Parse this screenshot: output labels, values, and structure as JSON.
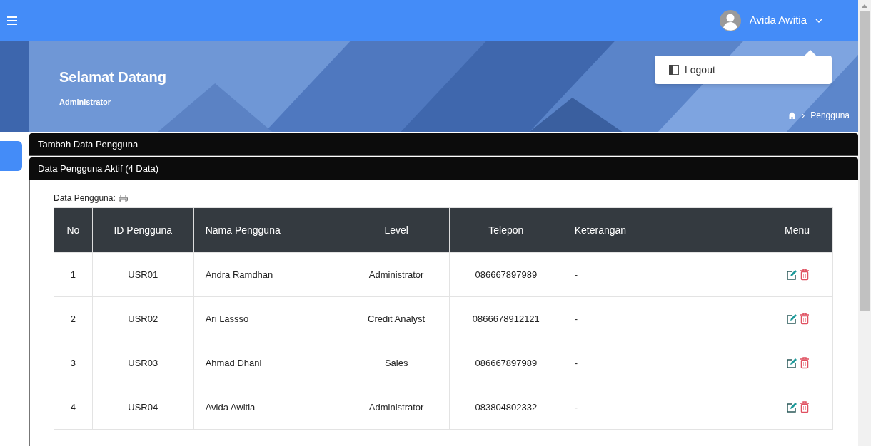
{
  "topbar": {
    "user_name": "Avida Awitia"
  },
  "user_menu": {
    "expanded": true,
    "items": [
      "Logout"
    ]
  },
  "banner": {
    "title": "Selamat Datang",
    "subtitle": "Administrator",
    "breadcrumb_separator": "›",
    "breadcrumb": "Pengguna"
  },
  "panels": [
    {
      "title": "Tambah Data Pengguna",
      "expanded": false
    },
    {
      "title": "Data Pengguna Aktif (4 Data)",
      "expanded": true
    }
  ],
  "table": {
    "caption": "Data Pengguna:",
    "columns": [
      "No",
      "ID Pengguna",
      "Nama Pengguna",
      "Level",
      "Telepon",
      "Keterangan",
      "Menu"
    ],
    "rows": [
      {
        "no": "1",
        "id": "USR01",
        "name": "Andra Ramdhan",
        "level_name": "Administrator",
        "phone": "086667897989",
        "note": "-"
      },
      {
        "no": "2",
        "id": "USR02",
        "name": "Ari Lassso",
        "level_name": "Credit Analyst",
        "phone": "0866678912121",
        "note": "-"
      },
      {
        "no": "3",
        "id": "USR03",
        "name": "Ahmad Dhani",
        "level_name": "Sales",
        "phone": "086667897989",
        "note": "-"
      },
      {
        "no": "4",
        "id": "USR04",
        "name": "Avida Awitia",
        "level_name": "Administrator",
        "phone": "083804802332",
        "note": "-"
      }
    ]
  }
}
